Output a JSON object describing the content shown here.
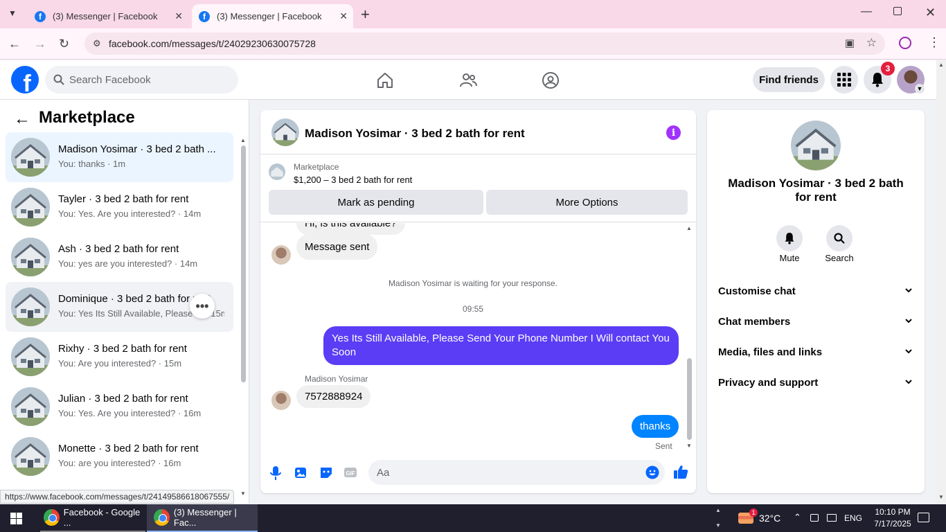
{
  "browser": {
    "tabs": [
      {
        "title": "(3) Messenger | Facebook"
      },
      {
        "title": "(3) Messenger | Facebook"
      }
    ],
    "url": "facebook.com/messages/t/24029230630075728",
    "status_url": "https://www.facebook.com/messages/t/24149586618067555/"
  },
  "fb": {
    "search_placeholder": "Search Facebook",
    "find_friends": "Find friends",
    "notification_count": "3"
  },
  "left": {
    "title": "Marketplace",
    "conversations": [
      {
        "name": "Madison Yosimar · 3 bed 2 bath ...",
        "sub": "You: thanks · 1m"
      },
      {
        "name": "Tayler · 3 bed 2 bath for rent",
        "sub": "You: Yes. Are you interested? · 14m"
      },
      {
        "name": "Ash · 3 bed 2 bath for rent",
        "sub": "You: yes are you interested? · 14m"
      },
      {
        "name": "Dominique · 3 bed 2 bath for rent",
        "sub": "You: Yes Its Still Available, Please ... · 15m"
      },
      {
        "name": "Rixhy · 3 bed 2 bath for rent",
        "sub": "You: Are you interested? · 15m"
      },
      {
        "name": "Julian · 3 bed 2 bath for rent",
        "sub": "You: Yes. Are you interested? · 16m"
      },
      {
        "name": "Monette · 3 bed 2 bath for rent",
        "sub": "You: are you interested? · 16m"
      }
    ]
  },
  "chat": {
    "header_title": "Madison Yosimar · 3 bed 2 bath for rent",
    "listing": {
      "source": "Marketplace",
      "summary": "$1,200 – 3 bed 2 bath for rent",
      "mark_pending": "Mark as pending",
      "more_options": "More Options"
    },
    "messages": {
      "partial_top": "Hi, is this available?",
      "message_sent": "Message sent",
      "waiting_notice": "Madison Yosimar is waiting for your response.",
      "time_divider": "09:55",
      "outgoing_long": "Yes Its Still Available, Please Send Your Phone Number I Will contact You Soon",
      "sender_name": "Madison Yosimar",
      "incoming_phone": "7572888924",
      "outgoing_thanks": "thanks",
      "sent_status": "Sent"
    },
    "composer_placeholder": "Aa"
  },
  "right": {
    "name": "Madison Yosimar · 3 bed 2 bath for rent",
    "mute_label": "Mute",
    "search_label": "Search",
    "sections": [
      "Customise chat",
      "Chat members",
      "Media, files and links",
      "Privacy and support"
    ]
  },
  "taskbar": {
    "app1": "Facebook - Google ...",
    "app2": "(3) Messenger | Fac...",
    "weather": "32°C",
    "weather_badge": "1",
    "language": "ENG",
    "time": "10:10 PM",
    "date": "7/17/2025"
  },
  "colors": {
    "fb_blue": "#0866ff",
    "messenger_blue": "#0084ff",
    "purple_bubble": "#5b3df5",
    "chrome_pink": "#f9d9e7"
  }
}
